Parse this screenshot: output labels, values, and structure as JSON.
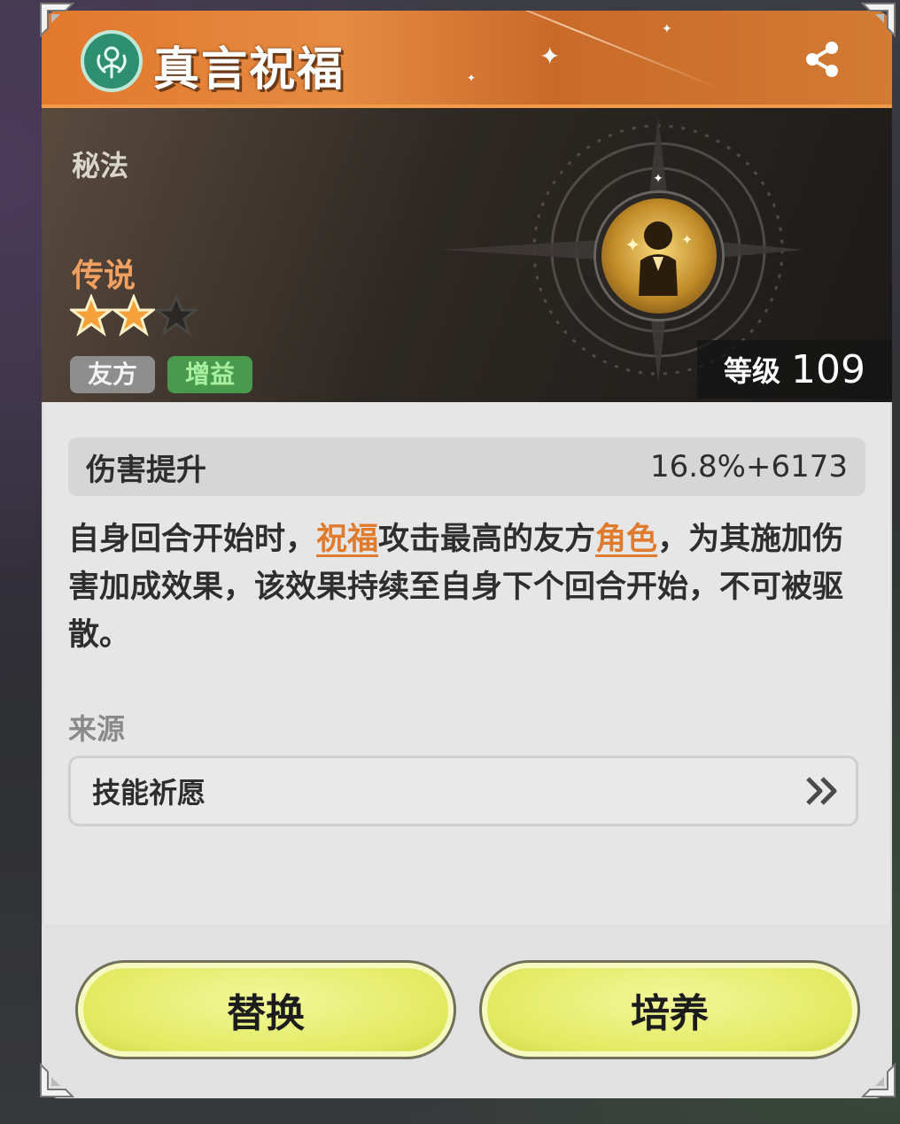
{
  "header": {
    "title": "真言祝福",
    "title_icon": "blessing-emblem-icon",
    "share_icon": "share-icon"
  },
  "hero": {
    "category": "秘法",
    "rarity": "传说",
    "stars_filled": 2,
    "stars_total": 3,
    "tags": [
      "友方",
      "增益"
    ],
    "level_label": "等级",
    "level_value": "109",
    "skill_icon": "praying-figure-icon"
  },
  "stat": {
    "name": "伤害提升",
    "value": "16.8%+6173"
  },
  "description": {
    "part1": "自身回合开始时，",
    "keyword1": "祝福",
    "part2": "攻击最高的友方",
    "keyword2": "角色",
    "part3": "，为其施加伤害加成效果，该效果持续至自身下个回合开始，不可被驱散。"
  },
  "source": {
    "label": "来源",
    "item": "技能祈愿",
    "arrow_icon": "double-chevron-right-icon"
  },
  "buttons": {
    "replace": "替换",
    "train": "培养"
  },
  "colors": {
    "header_orange": "#e2782c",
    "rarity_orange": "#f0a060",
    "keyword_orange": "#e07a2c",
    "button_yellow": "#e2ea60",
    "buff_green": "#4a9a4e"
  }
}
